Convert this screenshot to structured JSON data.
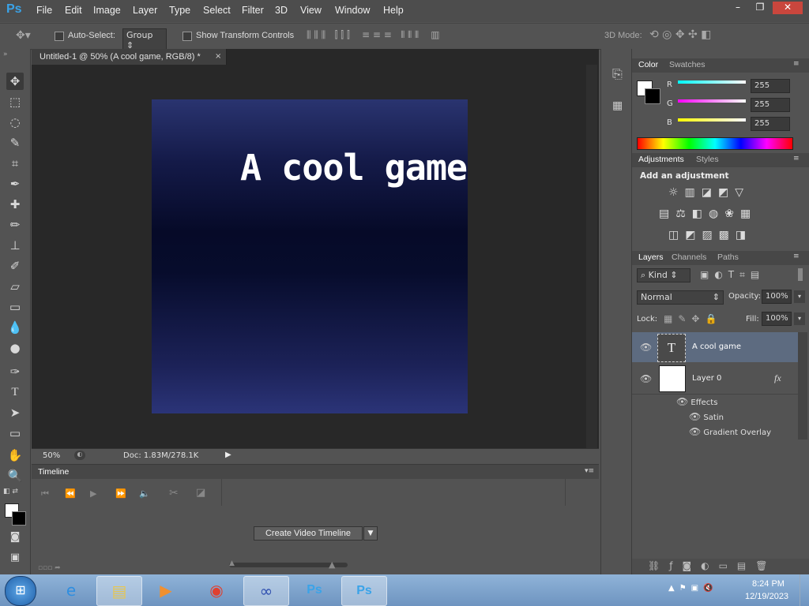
{
  "menubar": {
    "logo": "Ps",
    "items": [
      "File",
      "Edit",
      "Image",
      "Layer",
      "Type",
      "Select",
      "Filter",
      "3D",
      "View",
      "Window",
      "Help"
    ],
    "win_controls": [
      "–",
      "❐",
      "✕"
    ]
  },
  "options": {
    "auto_select_label": "Auto-Select:",
    "auto_select_value": "Group",
    "show_transform_label": "Show Transform Controls",
    "mode3d_label": "3D Mode:"
  },
  "document": {
    "tab_title": "Untitled-1 @ 50% (A cool game, RGB/8) *",
    "close": "×",
    "canvas_text": "A cool game",
    "zoom": "50%",
    "doc_info": "Doc: 1.83M/278.1K"
  },
  "timeline": {
    "title": "Timeline",
    "create_button": "Create Video Timeline"
  },
  "color_panel": {
    "tabs": [
      "Color",
      "Swatches"
    ],
    "channels": [
      {
        "label": "R",
        "value": "255",
        "color": "#00e5ff"
      },
      {
        "label": "G",
        "value": "255",
        "color": "#ff3cff"
      },
      {
        "label": "B",
        "value": "255",
        "color": "#ffff00"
      }
    ]
  },
  "adjustments_panel": {
    "tabs": [
      "Adjustments",
      "Styles"
    ],
    "heading": "Add an adjustment"
  },
  "layers_panel": {
    "tabs": [
      "Layers",
      "Channels",
      "Paths"
    ],
    "filter_kind": "Kind",
    "blend_mode": "Normal",
    "opacity_label": "Opacity:",
    "opacity_value": "100%",
    "lock_label": "Lock:",
    "fill_label": "Fill:",
    "fill_value": "100%",
    "layers": [
      {
        "name": "A cool game",
        "thumb": "T"
      },
      {
        "name": "Layer 0",
        "thumb": "",
        "fx": "fx"
      }
    ],
    "effects_label": "Effects",
    "effects": [
      "Satin",
      "Gradient Overlay"
    ]
  },
  "taskbar": {
    "time": "8:24 PM",
    "date": "12/19/2023"
  }
}
